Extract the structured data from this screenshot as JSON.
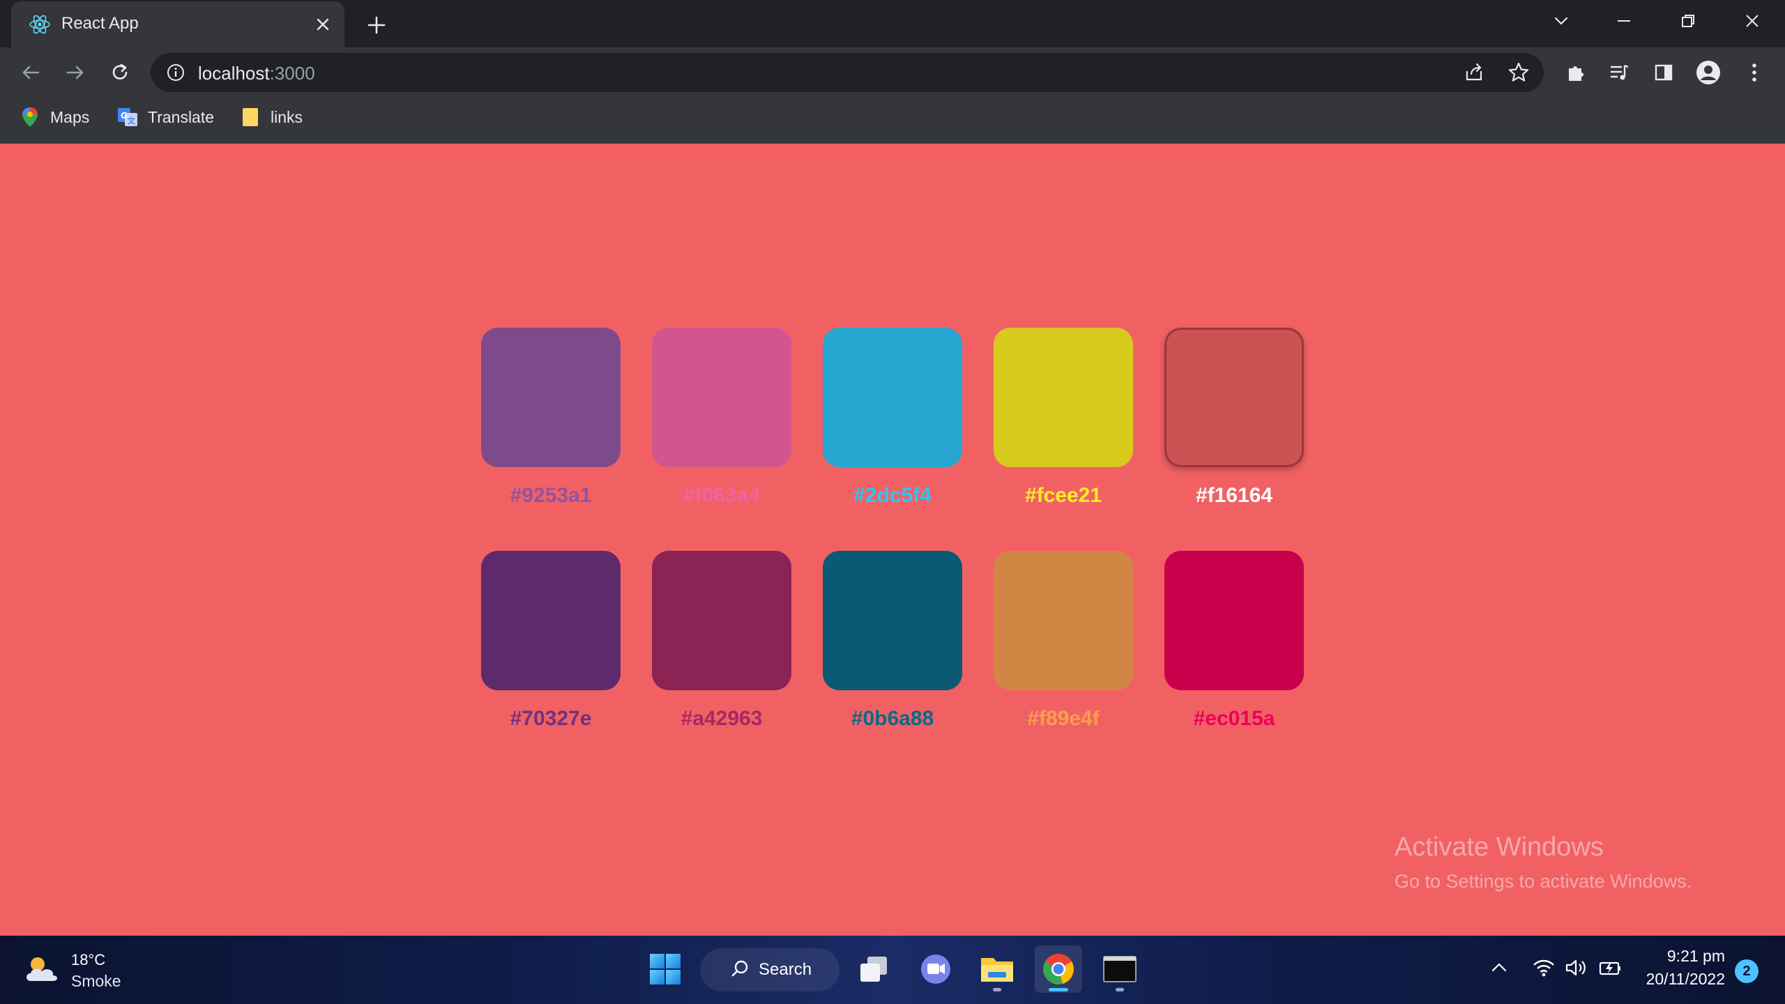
{
  "browser": {
    "tab": {
      "title": "React App",
      "favicon": "react-icon"
    },
    "window_controls": [
      "tab-search",
      "minimize",
      "restore",
      "close"
    ],
    "address_bar": {
      "host": "localhost",
      "port": ":3000"
    },
    "bookmarks": [
      {
        "label": "Maps",
        "icon": "maps-icon"
      },
      {
        "label": "Translate",
        "icon": "translate-icon"
      },
      {
        "label": "links",
        "icon": "folder-icon"
      }
    ]
  },
  "palette": {
    "rows": [
      [
        {
          "hex": "#9253a1",
          "swatch": "#7e4a8c",
          "active": false
        },
        {
          "hex": "#f063a4",
          "swatch": "#d0568d",
          "active": false
        },
        {
          "hex": "#2dc5f4",
          "swatch": "#26a6d1",
          "active": false
        },
        {
          "hex": "#fcee21",
          "swatch": "#d7ca1c",
          "active": false
        },
        {
          "hex": "#f16164",
          "swatch": "#cd5254",
          "active": true
        }
      ],
      [
        {
          "hex": "#70327e",
          "swatch": "#5f2a6b",
          "active": false
        },
        {
          "hex": "#a42963",
          "swatch": "#8b2354",
          "active": false
        },
        {
          "hex": "#0b6a88",
          "swatch": "#0a5a74",
          "active": false
        },
        {
          "hex": "#f89e4f",
          "swatch": "#d28643",
          "active": false
        },
        {
          "hex": "#ec015a",
          "swatch": "#c9014c",
          "active": false
        }
      ]
    ],
    "label_colors": {
      "#9253a1": "#9253a1",
      "#f063a4": "#f063a4",
      "#2dc5f4": "#2dc5f4",
      "#fcee21": "#fcee21",
      "#f16164": "#ffffff",
      "#70327e": "#70327e",
      "#a42963": "#a42963",
      "#0b6a88": "#0b6a88",
      "#f89e4f": "#f89e4f",
      "#ec015a": "#ec015a"
    }
  },
  "watermark": {
    "title": "Activate Windows",
    "subtitle": "Go to Settings to activate Windows."
  },
  "taskbar": {
    "weather": {
      "temp": "18°C",
      "condition": "Smoke"
    },
    "search_label": "Search",
    "clock": {
      "time": "9:21 pm",
      "date": "20/11/2022"
    },
    "notification_count": "2"
  }
}
